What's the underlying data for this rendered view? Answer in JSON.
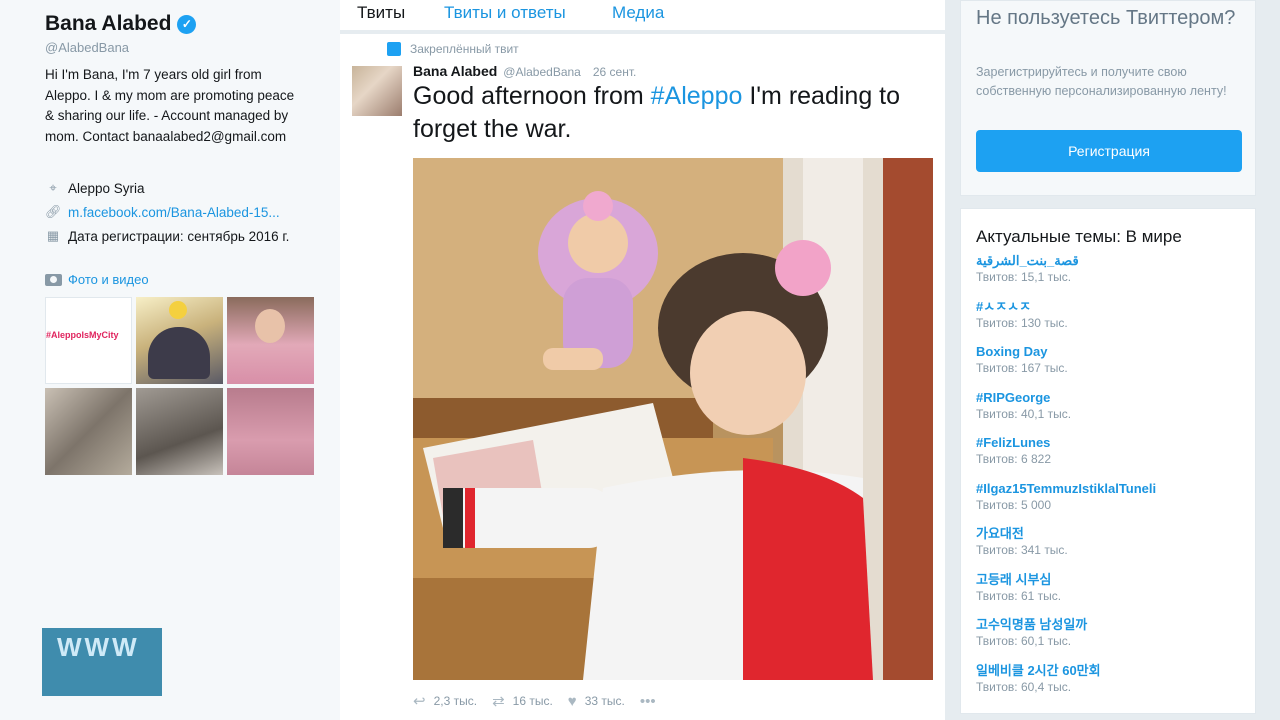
{
  "profile": {
    "name": "Bana Alabed",
    "handle": "@AlabedBana",
    "bio": "Hi I'm Bana, I'm 7 years old girl from Aleppo. I & my mom are promoting peace & sharing our life. - Account managed by mom. Contact banaalabed2@gmail.com",
    "location": "Aleppo Syria",
    "link": "m.facebook.com/Bana-Alabed-15...",
    "joined": "Дата регистрации: сентябрь 2016 г.",
    "media_label": "Фото и видео",
    "thumb1_text": "#AleppoIsMyCity"
  },
  "watermark": "WWW",
  "tabs": [
    "Твиты",
    "Твиты и ответы",
    "Медиа"
  ],
  "tweet": {
    "pinned_label": "Закреплённый твит",
    "author": "Bana Alabed",
    "handle": "@AlabedBana",
    "time": "26 сент.",
    "text_before": "Good afternoon from ",
    "hashtag": "#Aleppo",
    "text_after": " I'm reading to forget the war.",
    "replies": "2,3 тыс.",
    "retweets": "16 тыс.",
    "likes": "33 тыс.",
    "more": "•••"
  },
  "signup": {
    "title": "Не пользуетесь Твиттером?",
    "text": "Зарегистрируйтесь и получите свою собственную персонализированную ленту!",
    "button": "Регистрация"
  },
  "trends": {
    "title": "Актуальные темы: В мире",
    "items": [
      {
        "name": "قصة_بنت_الشرقية",
        "count": "Твитов: 15,1 тыс."
      },
      {
        "name": "#ㅅㅈㅅㅈ",
        "count": "Твитов: 130 тыс."
      },
      {
        "name": "Boxing Day",
        "count": "Твитов: 167 тыс."
      },
      {
        "name": "#RIPGeorge",
        "count": "Твитов: 40,1 тыс."
      },
      {
        "name": "#FelizLunes",
        "count": "Твитов: 6 822"
      },
      {
        "name": "#Ilgaz15TemmuzIstiklalTuneli",
        "count": "Твитов: 5 000"
      },
      {
        "name": "가요대전",
        "count": "Твитов: 341 тыс."
      },
      {
        "name": "고등래 시부심",
        "count": "Твитов: 61 тыс."
      },
      {
        "name": "고수익명품 남성일까",
        "count": "Твитов: 60,1 тыс."
      },
      {
        "name": "일베비클 2시간 60만회",
        "count": "Твитов: 60,4 тыс."
      }
    ]
  },
  "colors": {
    "accent": "#1da1f2",
    "link": "#1b95e0",
    "muted": "#8899a6",
    "page_bg": "#e6ecf0"
  }
}
